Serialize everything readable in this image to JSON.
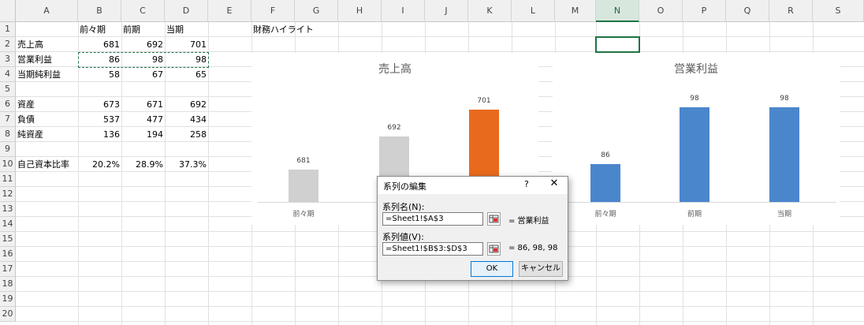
{
  "columns": [
    "A",
    "B",
    "C",
    "D",
    "E",
    "F",
    "G",
    "H",
    "I",
    "J",
    "K",
    "L",
    "M",
    "N",
    "O",
    "P",
    "Q",
    "R",
    "S"
  ],
  "rows": [
    "1",
    "2",
    "3",
    "4",
    "5",
    "6",
    "7",
    "8",
    "9",
    "10",
    "11",
    "12",
    "13",
    "14",
    "15",
    "16",
    "17",
    "18",
    "19",
    "20"
  ],
  "selected_column": "N",
  "cells": {
    "b1": "前々期",
    "c1": "前期",
    "d1": "当期",
    "f1": "財務ハイライト",
    "a2": "売上高",
    "b2": "681",
    "c2": "692",
    "d2": "701",
    "a3": "営業利益",
    "b3": "86",
    "c3": "98",
    "d3": "98",
    "a4": "当期純利益",
    "b4": "58",
    "c4": "67",
    "d4": "65",
    "a6": "資産",
    "b6": "673",
    "c6": "671",
    "d6": "692",
    "a7": "負債",
    "b7": "537",
    "c7": "477",
    "d7": "434",
    "a8": "純資産",
    "b8": "136",
    "c8": "194",
    "d8": "258",
    "a10": "自己資本比率",
    "b10": "20.2%",
    "c10": "28.9%",
    "d10": "37.3%"
  },
  "chart_data": [
    {
      "type": "bar",
      "title": "売上高",
      "categories": [
        "前々期",
        "前期",
        "当期"
      ],
      "values": [
        681,
        692,
        701
      ],
      "colors": [
        "#d0d0d0",
        "#d0d0d0",
        "#e86a1c"
      ],
      "ylim": [
        670,
        705
      ]
    },
    {
      "type": "bar",
      "title": "営業利益",
      "categories": [
        "前々期",
        "前期",
        "当期"
      ],
      "values": [
        86,
        98,
        98
      ],
      "colors": [
        "#4a86cc",
        "#4a86cc",
        "#4a86cc"
      ],
      "ylim": [
        78,
        100
      ]
    }
  ],
  "dialog": {
    "title": "系列の編集",
    "help": "?",
    "close": "✕",
    "name_label": "系列名(N):",
    "name_value": "=Sheet1!$A$3",
    "name_preview": "= 営業利益",
    "values_label": "系列値(V):",
    "values_value": "=Sheet1!$B$3:$D$3",
    "values_preview": "= 86, 98, 98",
    "ok": "OK",
    "cancel": "キャンセル"
  },
  "accent_color": "#217346"
}
